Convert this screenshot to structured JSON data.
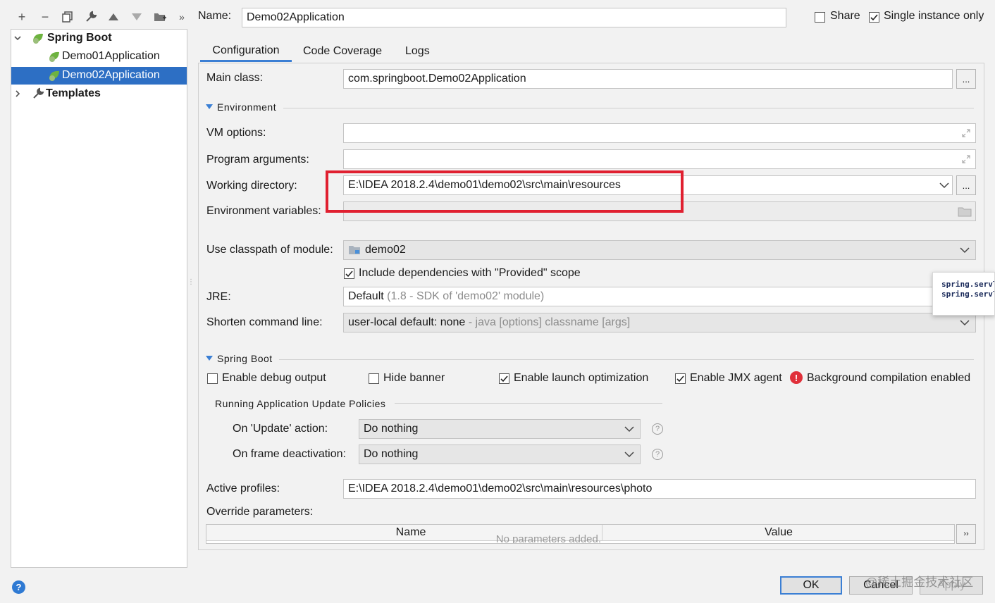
{
  "toolbar": {
    "add": "+",
    "remove": "−",
    "more": "»"
  },
  "tree": {
    "spring_boot": "Spring Boot",
    "item1": "Demo01Application",
    "item2": "Demo02Application",
    "templates": "Templates"
  },
  "header": {
    "name_label": "Name:",
    "name_value": "Demo02Application",
    "share_label": "Share",
    "single_instance_label": "Single instance only"
  },
  "tabs": [
    "Configuration",
    "Code Coverage",
    "Logs"
  ],
  "config": {
    "main_class_label": "Main class:",
    "main_class_value": "com.springboot.Demo02Application",
    "environment_section": "Environment",
    "vm_options_label": "VM options:",
    "program_args_label": "Program arguments:",
    "working_dir_label": "Working directory:",
    "working_dir_value": "E:\\IDEA 2018.2.4\\demo01\\demo02\\src\\main\\resources",
    "env_vars_label": "Environment variables:",
    "classpath_label": "Use classpath of module:",
    "classpath_value": "demo02",
    "include_deps_label": "Include dependencies with \"Provided\" scope",
    "jre_label": "JRE:",
    "jre_value": "Default",
    "jre_hint": "(1.8 - SDK of 'demo02' module)",
    "shorten_label": "Shorten command line:",
    "shorten_value": "user-local default: none",
    "shorten_hint": "- java [options] classname [args]",
    "spring_boot_section": "Spring Boot",
    "enable_debug_label": "Enable debug output",
    "hide_banner_label": "Hide banner",
    "launch_opt_label": "Enable launch optimization",
    "jmx_label": "Enable JMX agent",
    "bg_compile_label": "Background compilation enabled",
    "update_policies_title": "Running Application Update Policies",
    "on_update_label": "On 'Update' action:",
    "on_update_value": "Do nothing",
    "on_frame_label": "On frame deactivation:",
    "on_frame_value": "Do nothing",
    "active_profiles_label": "Active profiles:",
    "active_profiles_value": "E:\\IDEA 2018.2.4\\demo01\\demo02\\src\\main\\resources\\photo",
    "override_label": "Override parameters:",
    "col_name": "Name",
    "col_value": "Value",
    "empty_text": "No parameters added."
  },
  "tooltip": {
    "line1": "spring.servl",
    "line2": "spring.servl"
  },
  "footer": {
    "ok": "OK",
    "cancel": "Cancel",
    "apply": "Apply",
    "watermark": "@稀土掘金技术社区"
  },
  "colors": {
    "selection": "#2d6fc4",
    "highlight_box": "#e02030",
    "error": "#e0303a"
  }
}
